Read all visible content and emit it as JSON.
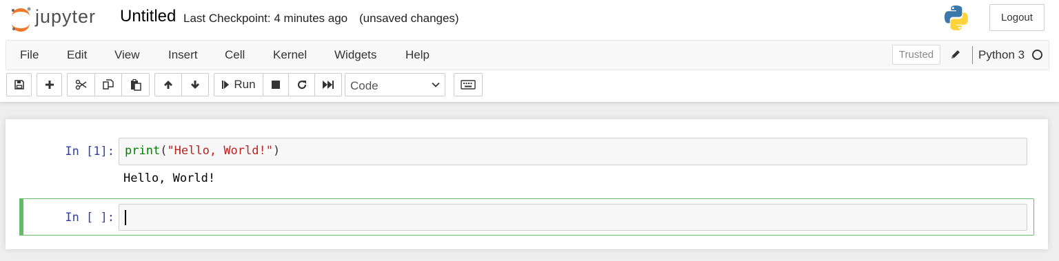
{
  "header": {
    "logo_text": "jupyter",
    "notebook_name": "Untitled",
    "checkpoint": "Last Checkpoint: 4 minutes ago",
    "save_status": "(unsaved changes)",
    "kernel_logo_icon": "python-logo-icon",
    "logout_label": "Logout"
  },
  "menubar": {
    "items": [
      "File",
      "Edit",
      "View",
      "Insert",
      "Cell",
      "Kernel",
      "Widgets",
      "Help"
    ],
    "trusted_label": "Trusted",
    "edit_icon": "pencil-icon",
    "kernel_name": "Python 3",
    "kernel_status_icon": "kernel-idle-circle-icon"
  },
  "toolbar": {
    "buttons": [
      {
        "name": "save",
        "icon": "save-icon"
      },
      {
        "name": "insert-cell-below",
        "icon": "plus-icon"
      },
      {
        "name": "cut",
        "icon": "scissors-icon"
      },
      {
        "name": "copy",
        "icon": "copy-icon"
      },
      {
        "name": "paste",
        "icon": "paste-icon"
      },
      {
        "name": "move-up",
        "icon": "arrow-up-icon"
      },
      {
        "name": "move-down",
        "icon": "arrow-down-icon"
      },
      {
        "name": "run",
        "icon": "step-forward-icon"
      },
      {
        "name": "interrupt",
        "icon": "stop-icon"
      },
      {
        "name": "restart",
        "icon": "restart-icon"
      },
      {
        "name": "restart-run-all",
        "icon": "fast-forward-icon"
      },
      {
        "name": "command-palette",
        "icon": "keyboard-icon"
      }
    ],
    "run_label": "Run",
    "cell_type": "Code"
  },
  "cells": [
    {
      "prompt": "In [1]:",
      "code": {
        "fn": "print",
        "open": "(",
        "str": "\"Hello, World!\"",
        "close": ")"
      },
      "output": "Hello, World!"
    },
    {
      "prompt": "In [ ]:",
      "code": ""
    }
  ],
  "colors": {
    "prompt": "#303f9f",
    "selected_cell_border": "#66bb6a",
    "code_function": "#008000",
    "code_string": "#ba2121"
  }
}
